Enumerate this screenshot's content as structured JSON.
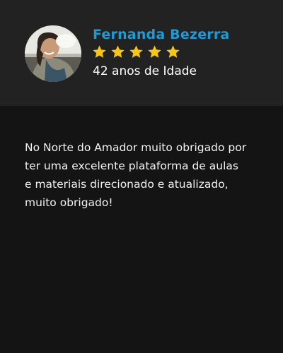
{
  "reviewer": {
    "name": "Fernanda Bezerra",
    "age_text": "42 anos de Idade",
    "rating": 5,
    "rating_max": 5,
    "star_color": "#f5c518",
    "name_color": "#1e9bd7"
  },
  "review": {
    "lines": [
      "No Norte do Amador muito obrigado por",
      "ter uma excelente plataforma de aulas",
      "e materiais direcionado e atualizado,",
      "muito obrigado!"
    ]
  }
}
